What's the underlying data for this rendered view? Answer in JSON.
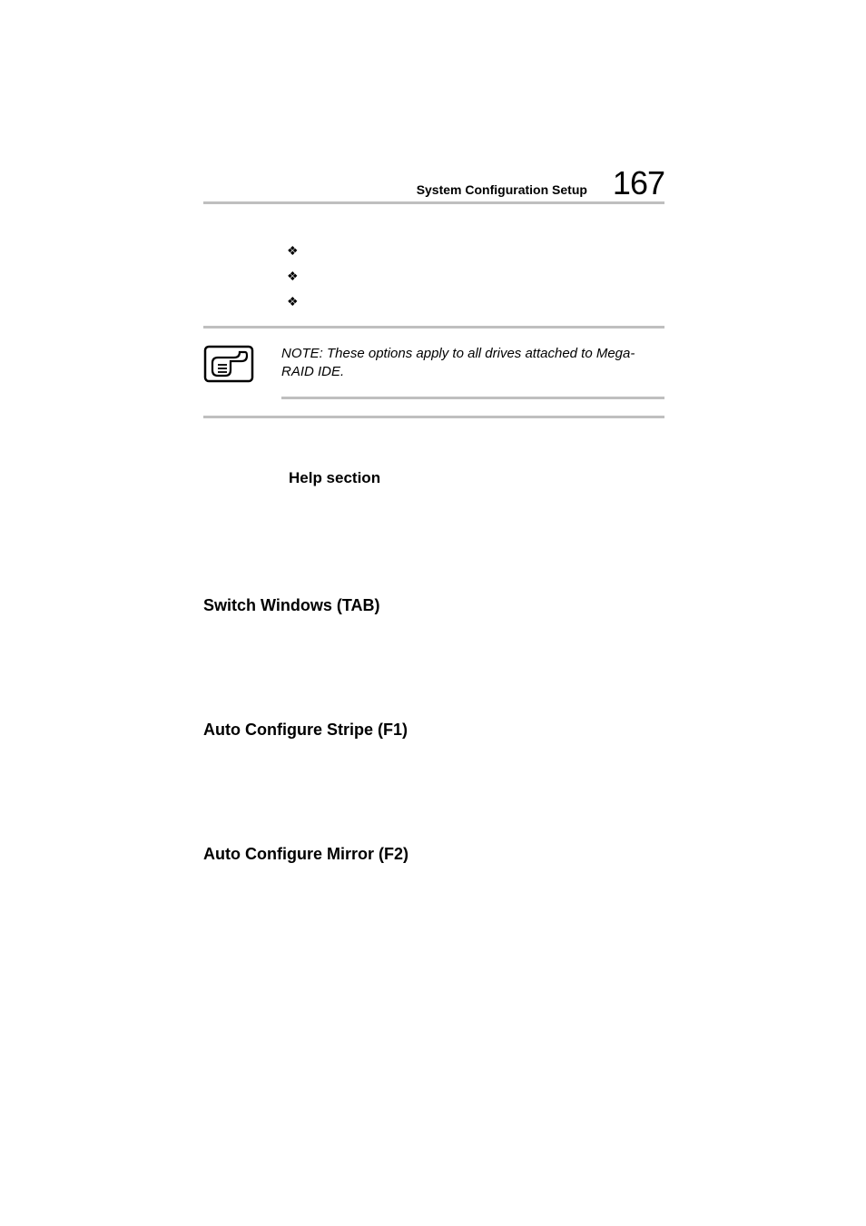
{
  "header": {
    "title": "System Configuration Setup",
    "page_number": "167"
  },
  "note": {
    "text": "NOTE: These options apply to all drives attached to Mega-RAID IDE."
  },
  "subheading": "Help section",
  "sections": [
    "Switch Windows (TAB)",
    "Auto Configure Stripe (F1)",
    "Auto Configure Mirror (F2)"
  ]
}
